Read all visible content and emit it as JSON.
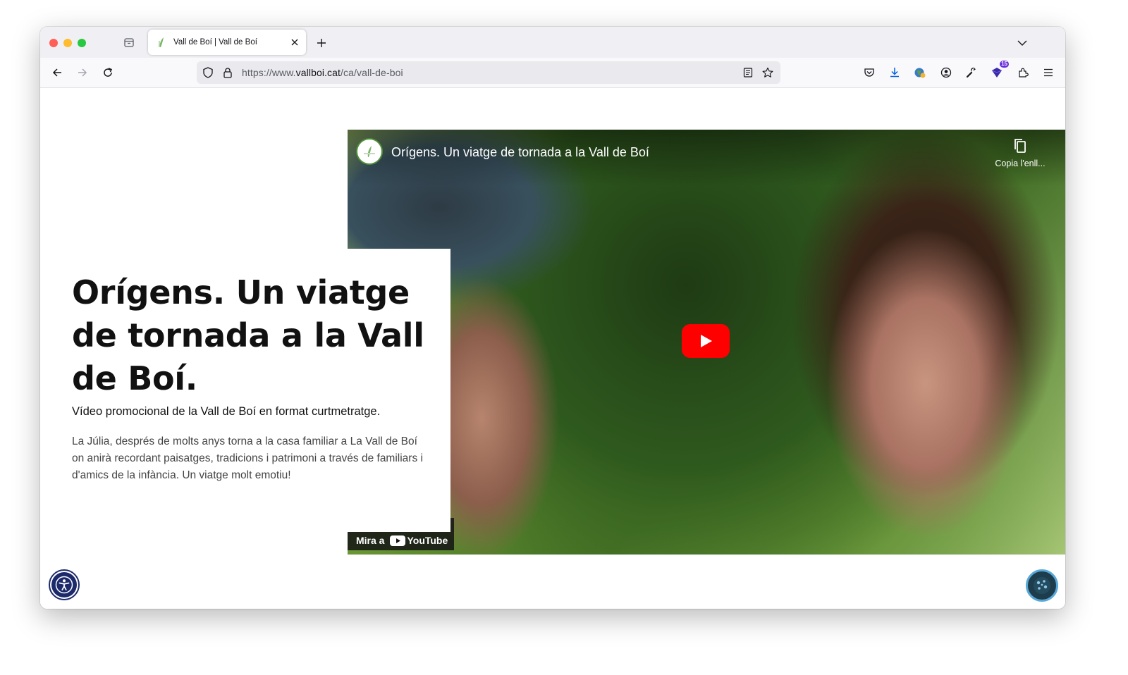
{
  "browser": {
    "tab": {
      "title": "Vall de Boí | Vall de Boí"
    },
    "url": {
      "prefix": "https://www.",
      "domain": "vallboi.cat",
      "path": "/ca/vall-de-boi"
    },
    "toolbar": {
      "extensions_badge": "15"
    },
    "icons": [
      "back-icon",
      "forward-icon",
      "reload-icon",
      "shield-icon",
      "lock-icon",
      "reader-view-icon",
      "bookmark-star-icon",
      "pocket-icon",
      "download-icon",
      "extension-globe-icon",
      "account-icon",
      "wrench-icon",
      "extension-badge-icon",
      "extensions-icon",
      "menu-icon"
    ]
  },
  "video": {
    "title": "Orígens. Un viatge de tornada a la Vall de Boí",
    "copy_link_label": "Copia l'enll...",
    "watch_on_label": "Mira a",
    "youtube_label": "YouTube"
  },
  "article": {
    "headline": "Orígens. Un viatge de tornada a la Vall de Boí.",
    "subtitle": "Vídeo promocional de la Vall de Boí en format curtmetratge.",
    "description": "La Júlia, després de molts anys torna a la casa familiar a La Vall de Boí on anirà recordant paisatges, tradicions i patrimoni a través de familiars i d'amics de la infància. Un viatge molt emotiu!"
  },
  "colors": {
    "play_button": "#ff0000",
    "accessibility_button": "#1c2a6b",
    "cookie_button_ring": "#58a8d8"
  }
}
